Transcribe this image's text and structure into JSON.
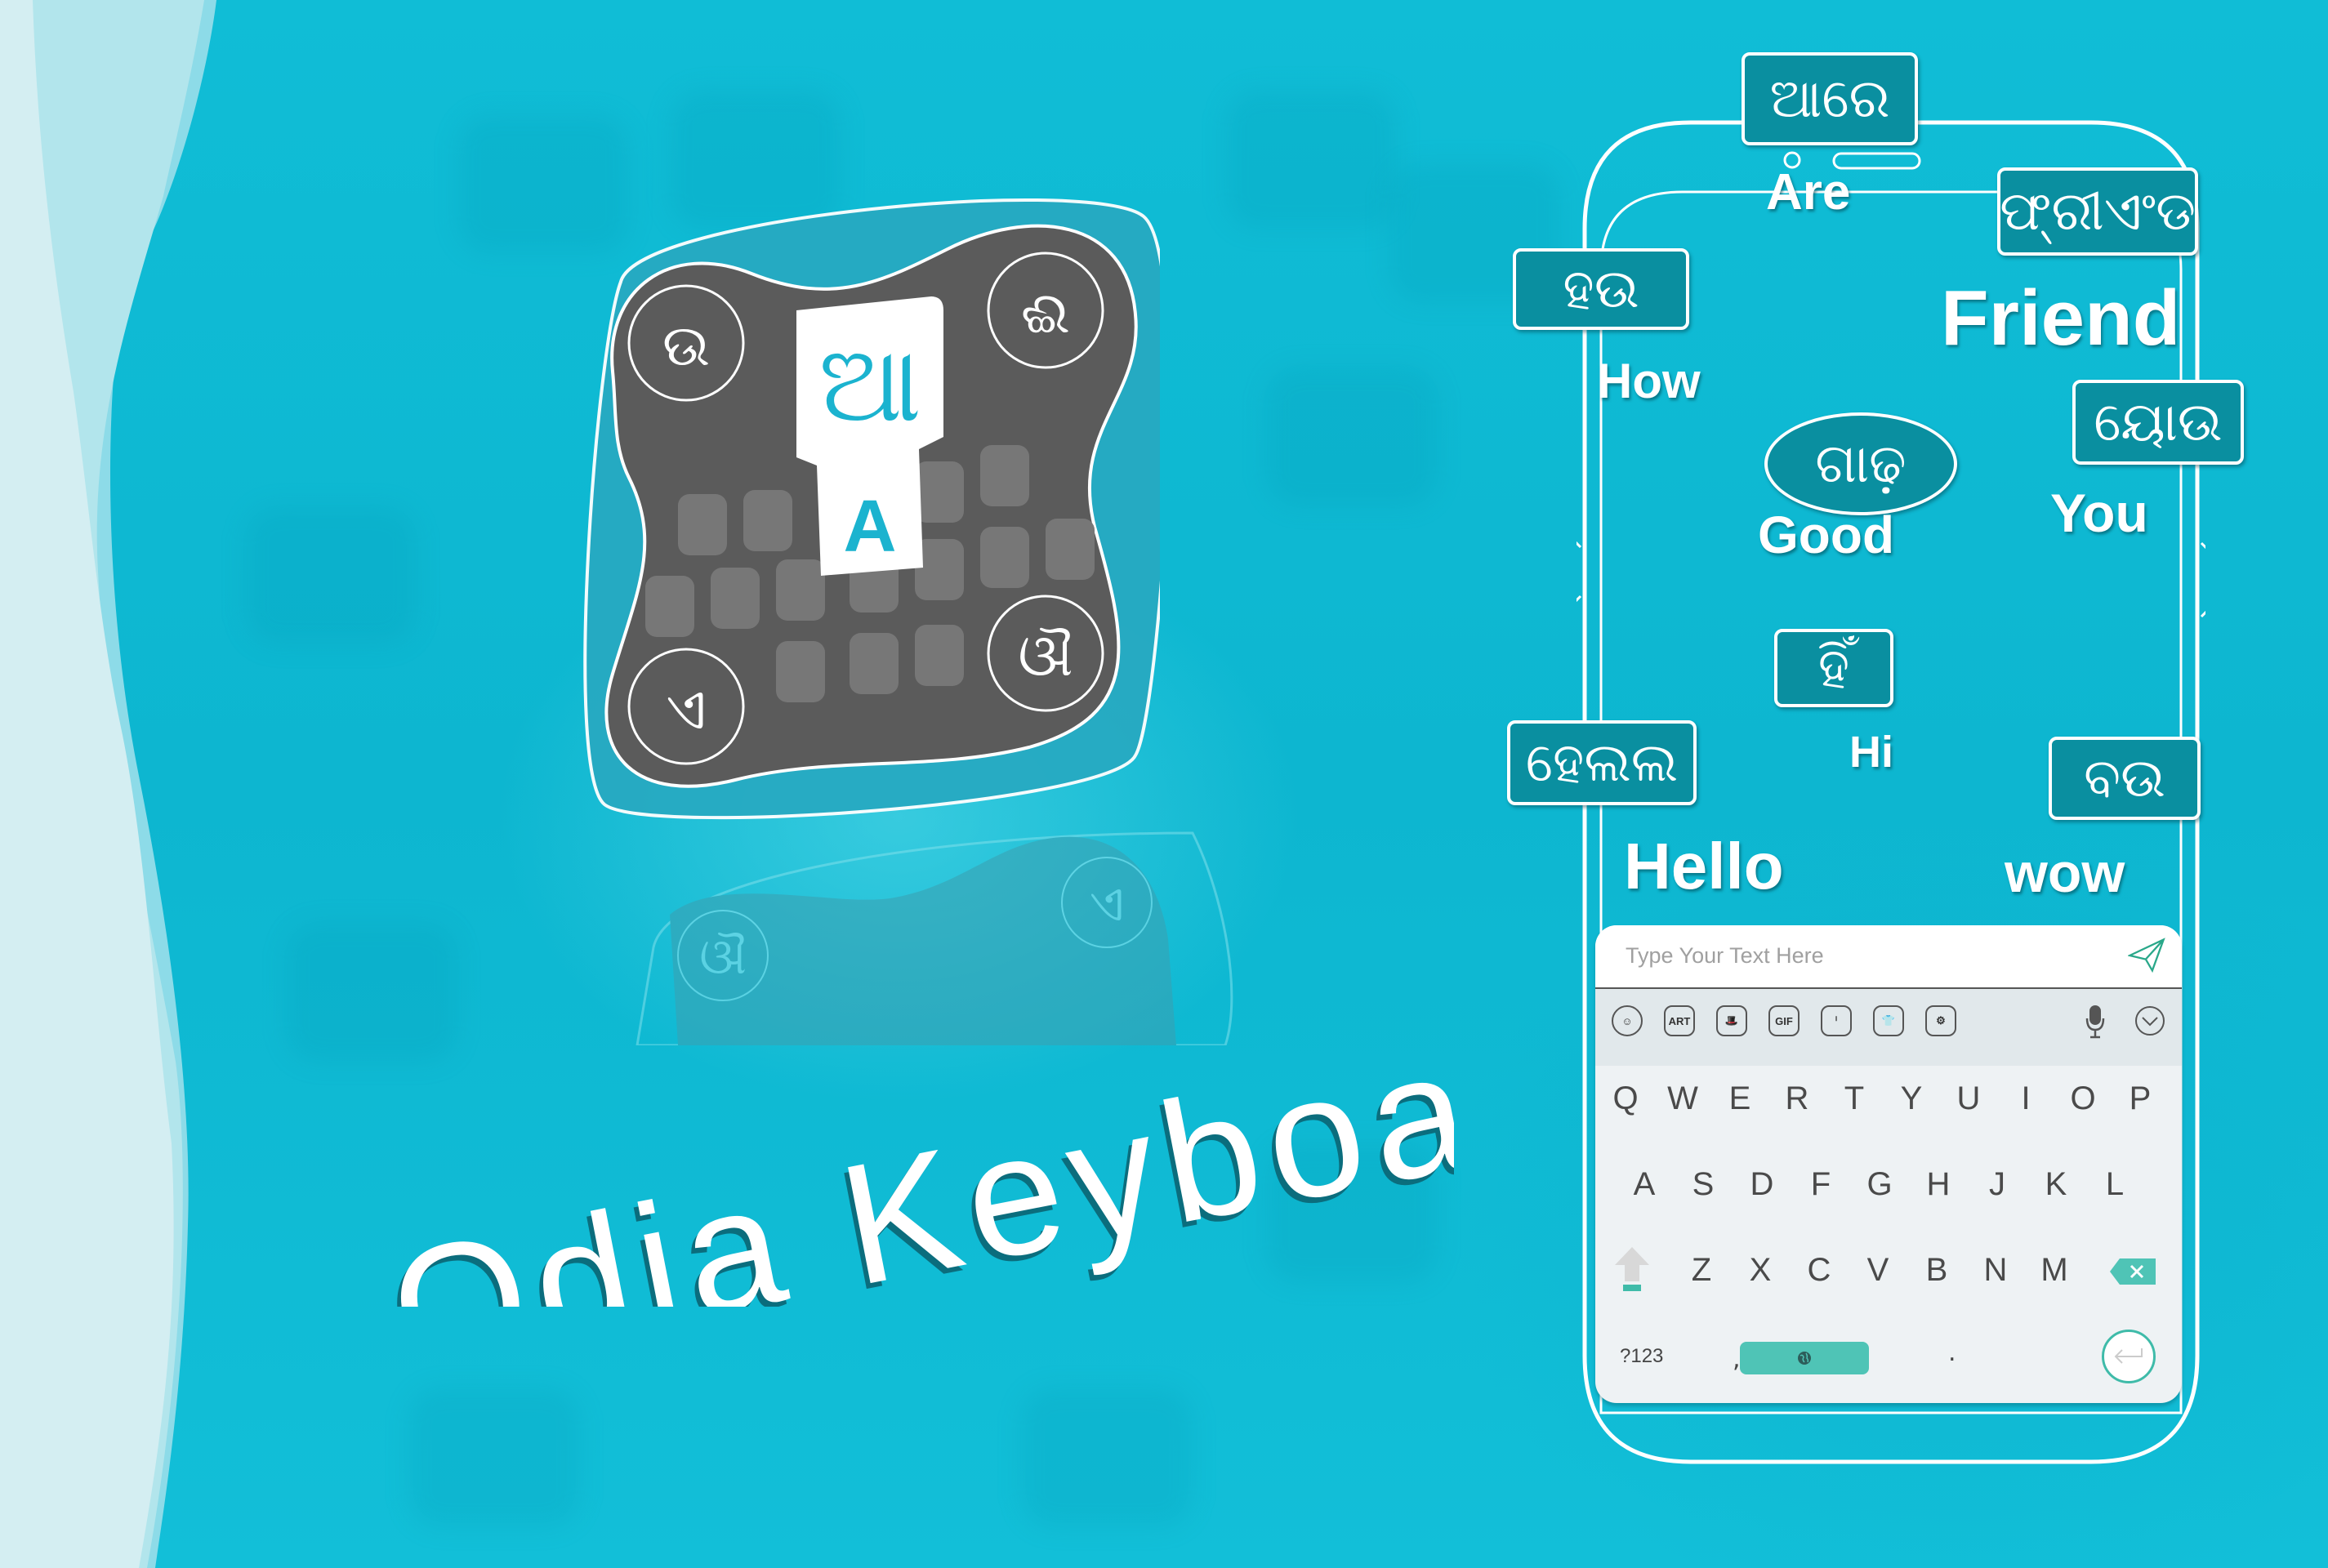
{
  "title": "Odia Keyboard",
  "colors": {
    "background": "#0fbdd6",
    "bubble_fill": "#0a8fa0",
    "accent_teal": "#4fc4b6",
    "icon_gray": "#5a5a5a",
    "icon_glyph_blue": "#1bb3cf",
    "wave_light": "#d4eef2"
  },
  "app_icon": {
    "center_key_odia": "ଆ",
    "center_key_latin": "A",
    "corner_glyphs": [
      "ଉ",
      "ଈ",
      "ଏ",
      "ଔ"
    ],
    "reflection_glyphs": [
      "ଔ",
      "ଏ"
    ]
  },
  "bubbles": [
    {
      "odia": "ଆରେ",
      "english": "Are"
    },
    {
      "odia": "ଫ୍ରୀଏଂଡ",
      "english": "Friend"
    },
    {
      "odia": "ହଉ",
      "english": "How"
    },
    {
      "odia": "ଗାଢ଼",
      "english": "Good"
    },
    {
      "odia": "ୟୋଉ",
      "english": "You"
    },
    {
      "odia": "ହିଁ",
      "english": "Hi"
    },
    {
      "odia": "ହେଲଲ",
      "english": "Hello"
    },
    {
      "odia": "ବଉ",
      "english": "wow"
    }
  ],
  "keyboard": {
    "input_placeholder": "Type Your Text Here",
    "send_icon": "paper-plane-icon",
    "toolbar": [
      {
        "name": "emoji",
        "label": "☺",
        "icon": "smiley-icon"
      },
      {
        "name": "art",
        "label": "ART",
        "icon": "art-icon"
      },
      {
        "name": "sticker",
        "label": "🎩",
        "icon": "hat-mustache-icon"
      },
      {
        "name": "gif",
        "label": "GIF",
        "icon": "gif-icon"
      },
      {
        "name": "emoticon",
        "label": "ⁱ",
        "icon": "face-icon"
      },
      {
        "name": "theme",
        "label": "👕",
        "icon": "shirt-icon"
      },
      {
        "name": "settings",
        "label": "⚙",
        "icon": "gear-icon"
      }
    ],
    "mic_icon": "microphone-icon",
    "collapse_icon": "chevron-down-icon",
    "rows": [
      [
        "Q",
        "W",
        "E",
        "R",
        "T",
        "Y",
        "U",
        "I",
        "O",
        "P"
      ],
      [
        "A",
        "S",
        "D",
        "F",
        "G",
        "H",
        "J",
        "K",
        "L"
      ],
      [
        "Z",
        "X",
        "C",
        "V",
        "B",
        "N",
        "M"
      ]
    ],
    "symbols_label": "?123",
    "comma_label": ",",
    "period_label": ".",
    "space_icon": "globe-icon",
    "enter_icon": "return-arrow-icon"
  }
}
